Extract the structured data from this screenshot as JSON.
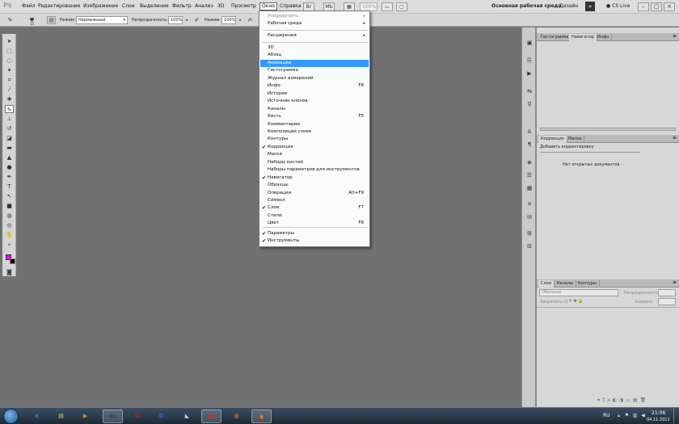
{
  "menubar": {
    "logo": "Ps",
    "items": [
      "Файл",
      "Редактирование",
      "Изображение",
      "Слои",
      "Выделение",
      "Фильтр",
      "Анализ",
      "3D",
      "Просмотр",
      "Окно",
      "Справка"
    ],
    "active_item": "Окно",
    "zoom": "100%",
    "workspace": "Основная рабочая среда",
    "design": "Дизайн",
    "cs_live": "CS Live"
  },
  "options": {
    "brush_size": "15",
    "mode_label": "Режим:",
    "mode_value": "Нормальный",
    "opacity_label": "Непрозрачность:",
    "opacity_value": "100%",
    "pressure_label": "Нажим:",
    "pressure_value": "100%"
  },
  "window_menu": {
    "top_items": [
      {
        "label": "Упорядочить",
        "disabled": true,
        "submenu": true
      },
      {
        "label": "Рабочая среда",
        "disabled": false,
        "submenu": true
      }
    ],
    "extensions": {
      "label": "Расширения",
      "submenu": true
    },
    "panels": [
      {
        "label": "3D",
        "checked": false,
        "shortcut": ""
      },
      {
        "label": "Абзац",
        "checked": false,
        "shortcut": ""
      },
      {
        "label": "Анимация",
        "checked": false,
        "shortcut": "",
        "highlight": true
      },
      {
        "label": "Гистограмма",
        "checked": false,
        "shortcut": ""
      },
      {
        "label": "Журнал измерений",
        "checked": false,
        "shortcut": ""
      },
      {
        "label": "Инфо",
        "checked": false,
        "shortcut": "F8"
      },
      {
        "label": "История",
        "checked": false,
        "shortcut": ""
      },
      {
        "label": "Источник клонов",
        "checked": false,
        "shortcut": ""
      },
      {
        "label": "Каналы",
        "checked": false,
        "shortcut": ""
      },
      {
        "label": "Кисть",
        "checked": false,
        "shortcut": "F5"
      },
      {
        "label": "Комментарии",
        "checked": false,
        "shortcut": ""
      },
      {
        "label": "Композиции слоев",
        "checked": false,
        "shortcut": ""
      },
      {
        "label": "Контуры",
        "checked": false,
        "shortcut": ""
      },
      {
        "label": "Коррекция",
        "checked": true,
        "shortcut": ""
      },
      {
        "label": "Маски",
        "checked": false,
        "shortcut": ""
      },
      {
        "label": "Наборы кистей",
        "checked": false,
        "shortcut": ""
      },
      {
        "label": "Наборы параметров для инструментов",
        "checked": false,
        "shortcut": ""
      },
      {
        "label": "Навигатор",
        "checked": true,
        "shortcut": ""
      },
      {
        "label": "Образцы",
        "checked": false,
        "shortcut": ""
      },
      {
        "label": "Операции",
        "checked": false,
        "shortcut": "Alt+F9"
      },
      {
        "label": "Символ",
        "checked": false,
        "shortcut": ""
      },
      {
        "label": "Слои",
        "checked": true,
        "shortcut": "F7"
      },
      {
        "label": "Стили",
        "checked": false,
        "shortcut": ""
      },
      {
        "label": "Цвет",
        "checked": false,
        "shortcut": "F6"
      }
    ],
    "bottom_items": [
      {
        "label": "Параметры",
        "checked": true
      },
      {
        "label": "Инструменты",
        "checked": true
      }
    ]
  },
  "panels": {
    "top_tabs": [
      "Гистограмма",
      "Навигатор",
      "Инфо"
    ],
    "top_active": "Навигатор",
    "mid_tabs": [
      "Коррекция",
      "Маски"
    ],
    "mid_active": "Коррекция",
    "adjust_title": "Добавить корректировку",
    "no_docs": "Нет открытых документов",
    "layer_tabs": [
      "Слои",
      "Каналы",
      "Контуры"
    ],
    "layer_active": "Слои",
    "blend_mode": "Обычные",
    "layer_opacity_label": "Непрозрачность:",
    "lock_label": "Закрепить:",
    "fill_label": "Заливка:"
  },
  "taskbar": {
    "lang": "RU",
    "time": "21:06",
    "date": "04.11.2011",
    "apps": [
      {
        "name": "ie-icon",
        "glyph": "e",
        "color": "#2f7fd8",
        "open": false
      },
      {
        "name": "explorer-icon",
        "glyph": "▤",
        "color": "#e5c56a",
        "open": false
      },
      {
        "name": "media-player-icon",
        "glyph": "▶",
        "color": "#e38a1d",
        "open": false
      },
      {
        "name": "photoshop-icon",
        "glyph": "Ps",
        "color": "#1f4f8f",
        "open": true
      },
      {
        "name": "opera-icon",
        "glyph": "O",
        "color": "#d4101b",
        "open": false
      },
      {
        "name": "app-d-icon",
        "glyph": "D",
        "color": "#2a66c8",
        "open": false
      },
      {
        "name": "fox-icon",
        "glyph": "◣",
        "color": "#cfcfcf",
        "open": false
      },
      {
        "name": "games-icon",
        "glyph": "64",
        "color": "#c0392b",
        "open": true
      },
      {
        "name": "mail-icon",
        "glyph": "@",
        "color": "#e2742a",
        "open": false
      },
      {
        "name": "firefox-icon",
        "glyph": "◉",
        "color": "#e67e22",
        "open": true
      }
    ]
  }
}
